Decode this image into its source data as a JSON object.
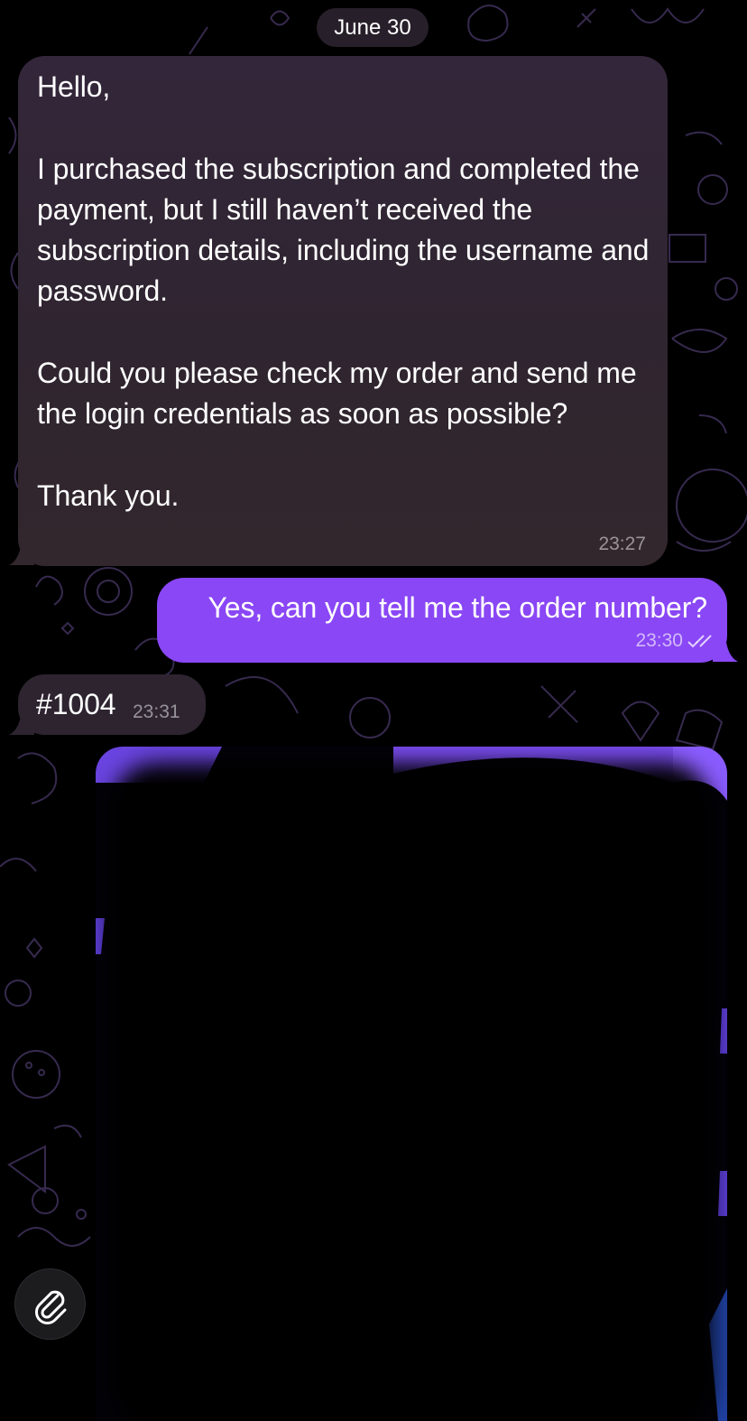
{
  "chat": {
    "date_separator": "June 30",
    "messages": [
      {
        "direction": "incoming",
        "paragraphs": [
          "Hello,",
          "I purchased the subscription and completed the payment, but I still haven’t received the subscription details, including the username and password.",
          "Could you please check my order and send me the login credentials as soon as possible?",
          "Thank you."
        ],
        "time": "23:27"
      },
      {
        "direction": "outgoing",
        "text": "Yes, can you tell me the order number?",
        "time": "23:30",
        "status_icon": "double-check-icon"
      },
      {
        "direction": "incoming",
        "text": "#1004",
        "time": "23:31"
      },
      {
        "direction": "incoming",
        "type": "media",
        "obscured": true
      }
    ]
  },
  "attach_button": {
    "icon": "paperclip-icon"
  },
  "colors": {
    "incoming_bubble": "#2d2430",
    "outgoing_bubble": "#8a47f5",
    "background": "#000000",
    "wallpaper_doodle": "#4a3768"
  }
}
